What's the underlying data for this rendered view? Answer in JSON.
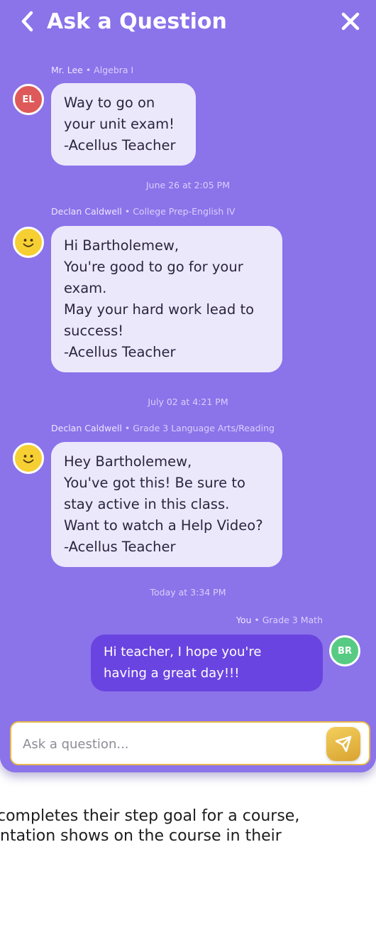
{
  "header": {
    "title": "Ask a Question",
    "back_icon": "chevron-left-icon",
    "close_icon": "close-icon"
  },
  "messages": [
    {
      "meta_name": "Mr. Lee",
      "meta_course": " • Algebra I",
      "avatar": "EL",
      "avatar_color": "#de5a5a",
      "lines": [
        "Way to go on",
        "your unit exam!",
        "-Acellus Teacher"
      ]
    },
    {
      "timestamp": "June 26 at 2:05 PM",
      "meta_name": "Declan Caldwell",
      "meta_course": " • College Prep-English IV",
      "avatar": "smiley-face",
      "lines": [
        "Hi Bartholemew,",
        "You're good to go for your",
        "exam.",
        "May your hard work lead to",
        "success!",
        "-Acellus Teacher"
      ]
    },
    {
      "timestamp": "July 02 at 4:21 PM",
      "meta_name": "Declan Caldwell",
      "meta_course": " • Grade 3 Language Arts/Reading",
      "avatar": "smiley-face",
      "lines": [
        "Hey Bartholemew,",
        "You've got this! Be sure to",
        "stay active in this class.",
        "Want to watch a Help Video?",
        "-Acellus Teacher"
      ]
    },
    {
      "timestamp": "Today at 3:34 PM",
      "meta_name": "You",
      "meta_course": " • Grade 3 Math",
      "avatar": "BR",
      "avatar_color": "#57cb83",
      "lines": [
        "Hi teacher, I hope you're",
        "having a great day!!!"
      ]
    }
  ],
  "composer": {
    "placeholder": "Ask a question...",
    "send_icon": "send-icon"
  },
  "caption": {
    "line1": "completes their step goal for a course,",
    "line2": "ntation shows on the course in their"
  },
  "colors": {
    "panel": "#8b73ea",
    "bubble": "#ece8fb",
    "my_bubble": "#6a44e0",
    "accent": "#e8b94a"
  }
}
